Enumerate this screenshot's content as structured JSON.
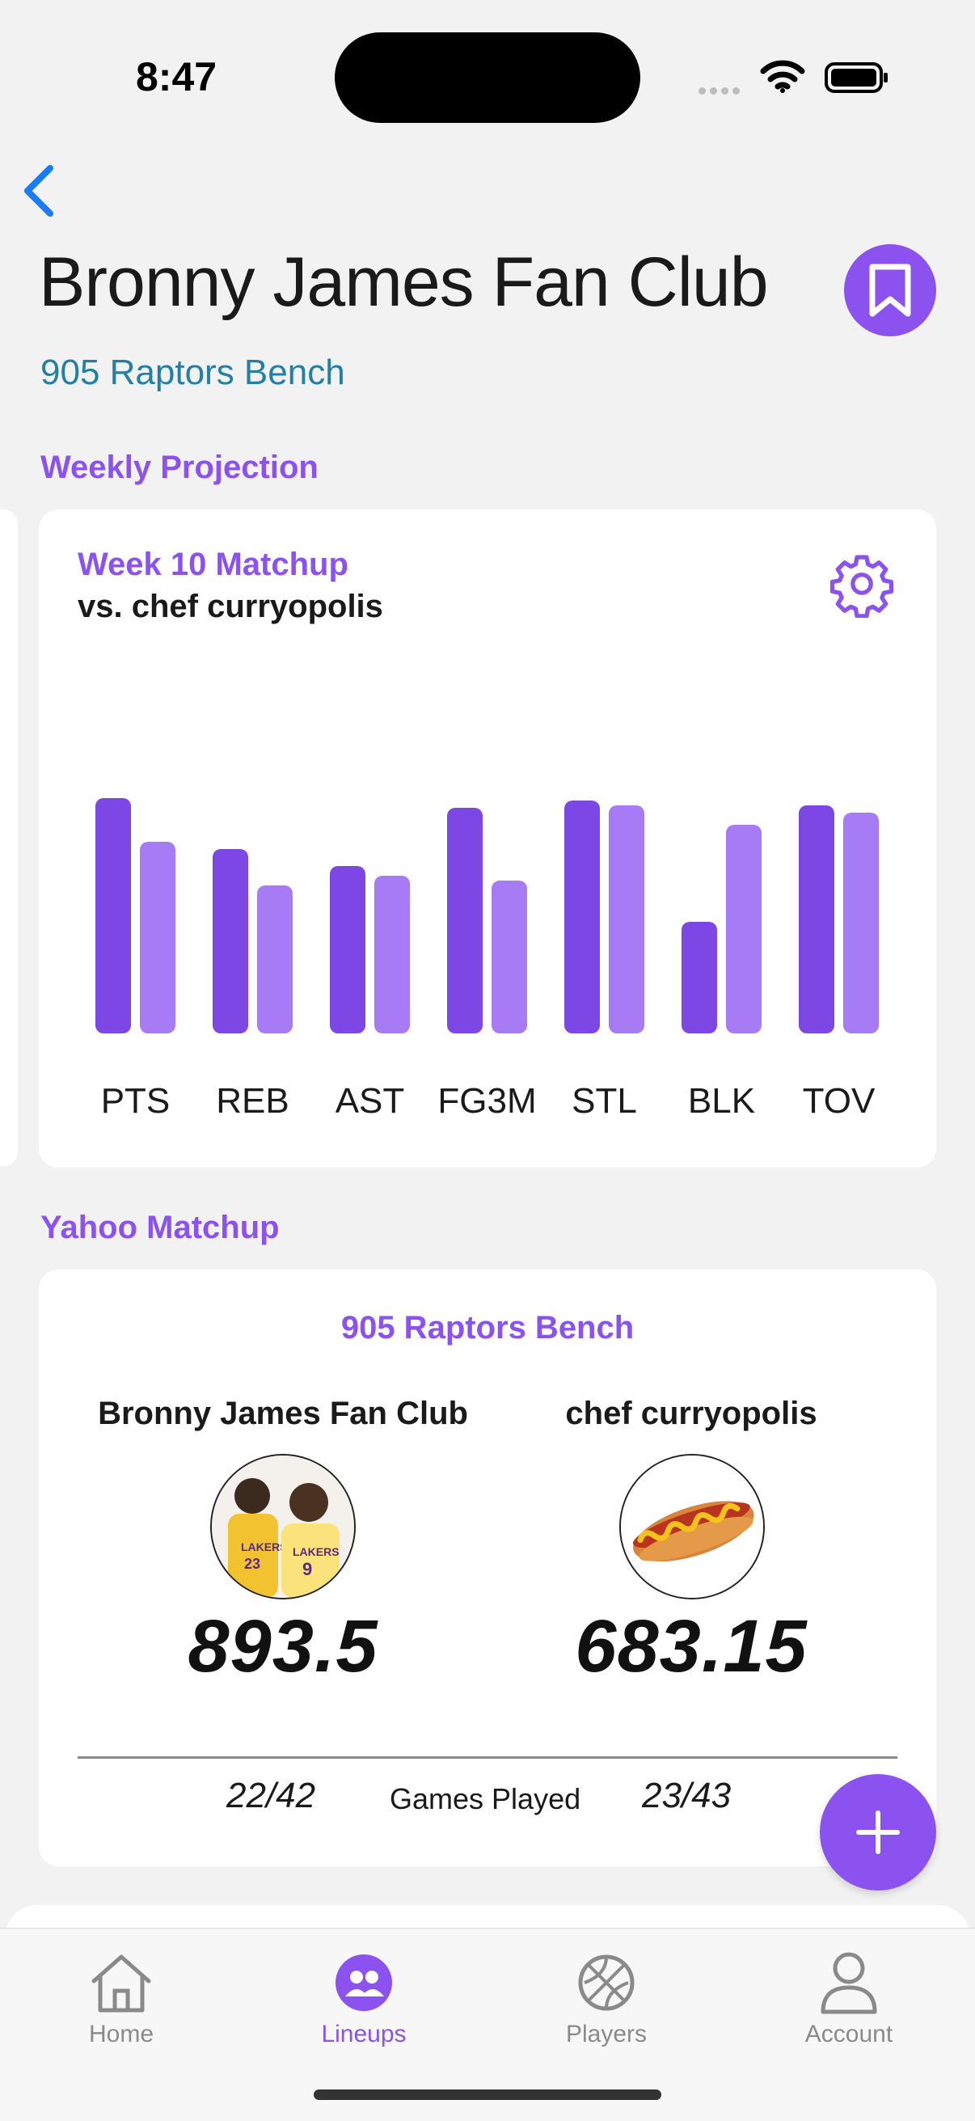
{
  "status_bar": {
    "time": "8:47"
  },
  "header": {
    "title": "Bronny James Fan Club",
    "subtitle": "905 Raptors Bench"
  },
  "weekly_projection": {
    "section_label": "Weekly Projection",
    "week_label": "Week 10 Matchup",
    "opponent_label": "vs. chef curryopolis"
  },
  "chart_data": {
    "type": "bar",
    "categories": [
      "PTS",
      "REB",
      "AST",
      "FG3M",
      "STL",
      "BLK",
      "TOV"
    ],
    "series": [
      {
        "values": [
          0.97,
          0.76,
          0.69,
          0.93,
          0.96,
          0.46,
          0.94
        ],
        "color": "#7c47e4"
      },
      {
        "values": [
          0.79,
          0.61,
          0.65,
          0.63,
          0.94,
          0.86,
          0.91
        ],
        "color": "#a77bf6"
      }
    ],
    "ylim": [
      0,
      1
    ]
  },
  "yahoo_matchup": {
    "section_label": "Yahoo Matchup",
    "league_name": "905 Raptors Bench",
    "team_left": {
      "name": "Bronny James Fan Club",
      "score": "893.5",
      "games": "22/42"
    },
    "team_right": {
      "name": "chef curryopolis",
      "score": "683.15",
      "games": "23/43"
    },
    "games_played_label": "Games Played"
  },
  "tabs": [
    {
      "label": "Home",
      "icon": "home-icon",
      "active": false
    },
    {
      "label": "Lineups",
      "icon": "lineups-icon",
      "active": true
    },
    {
      "label": "Players",
      "icon": "basketball-icon",
      "active": false
    },
    {
      "label": "Account",
      "icon": "account-icon",
      "active": false
    }
  ],
  "colors": {
    "accent": "#8c52f0",
    "link": "#237fa4"
  }
}
